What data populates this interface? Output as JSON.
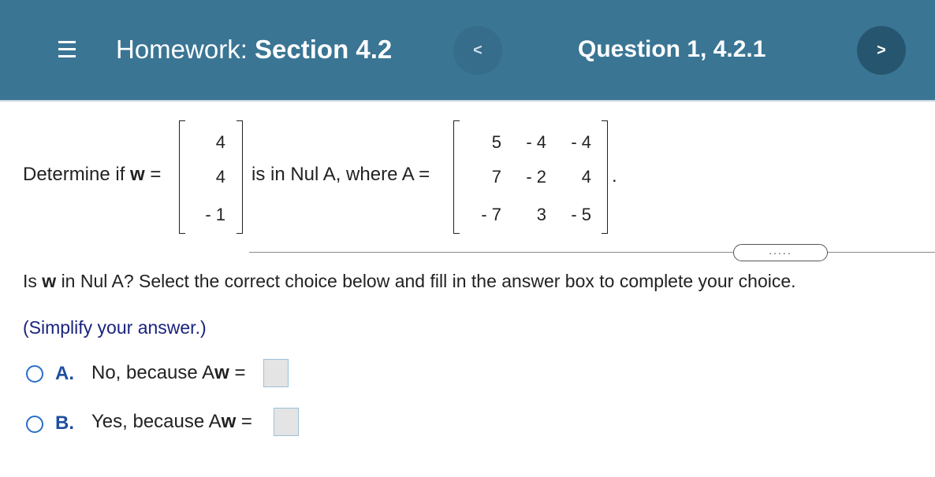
{
  "header": {
    "title_prefix": "Homework:",
    "title_section": "Section 4.2",
    "question_label": "Question 1, 4.2.1",
    "prev_symbol": "<",
    "next_symbol": ">"
  },
  "problem": {
    "lead_text": "Determine if",
    "w_symbol": "w",
    "eq": "=",
    "mid_text": "is in Nul A, where A",
    "end_period": ".",
    "w_vector": [
      "4",
      "4",
      "- 1"
    ],
    "A_matrix": [
      [
        "5",
        "- 4",
        "- 4"
      ],
      [
        "7",
        "- 2",
        "4"
      ],
      [
        "- 7",
        "3",
        "- 5"
      ]
    ]
  },
  "more_button": ".....",
  "prompt": {
    "pre": "Is",
    "w": "w",
    "post": "in Nul A? Select the correct choice below and fill in the answer box to complete your choice.",
    "hint": "(Simplify your answer.)"
  },
  "options": [
    {
      "letter": "A.",
      "text": "No, because A",
      "w": "w",
      "eq": "="
    },
    {
      "letter": "B.",
      "text": "Yes, because A",
      "w": "w",
      "eq": "="
    }
  ],
  "colors": {
    "header_bg": "#3a7594",
    "option_letter": "#1f4f9e",
    "hint_text": "#1a237e",
    "radio_border": "#2a6ec9"
  }
}
